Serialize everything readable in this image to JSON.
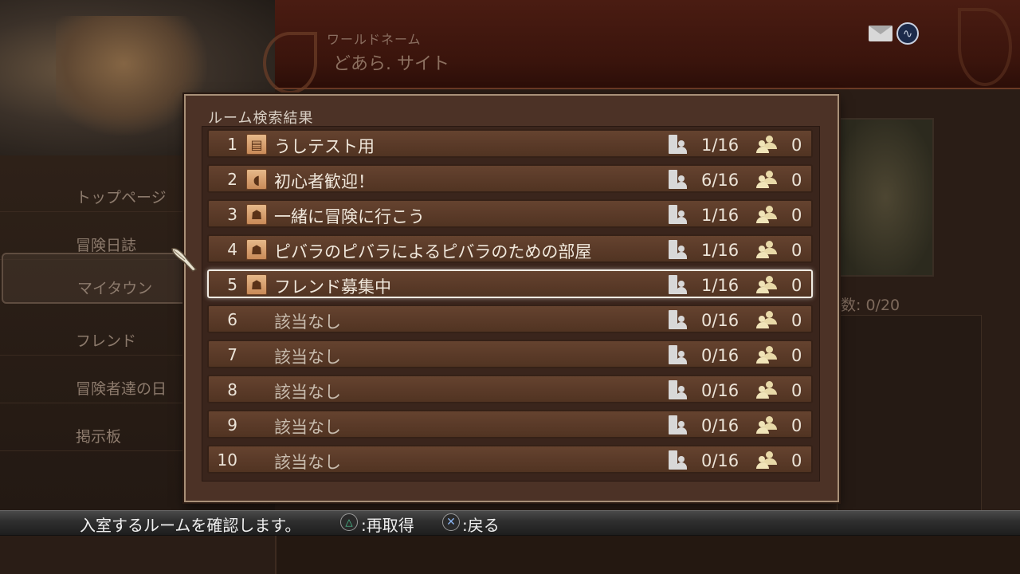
{
  "header": {
    "world_label": "ワールドネーム",
    "world_name": "どあら. サイト",
    "mail_icon": "mail-icon",
    "status_icon": "network-status-icon"
  },
  "side_menu": {
    "items": [
      {
        "label": "トップページ"
      },
      {
        "label": "冒険日誌"
      },
      {
        "label": "マイタウン",
        "selected": true
      },
      {
        "label": "フレンド"
      },
      {
        "label": "冒険者達の日"
      },
      {
        "label": "掲示板"
      }
    ]
  },
  "right_panel": {
    "count_label": "数:",
    "count_value": "0/20"
  },
  "dialog": {
    "title": "ルーム検索結果",
    "rooms": [
      {
        "num": "1",
        "icon": "note-icon",
        "name": "うしテスト用",
        "occupancy": "1/16",
        "members": "0"
      },
      {
        "num": "2",
        "icon": "beginner-icon",
        "name": "初心者歓迎！",
        "occupancy": "6/16",
        "members": "0"
      },
      {
        "num": "3",
        "icon": "party-icon",
        "name": "一緒に冒険に行こう",
        "occupancy": "1/16",
        "members": "0"
      },
      {
        "num": "4",
        "icon": "friends-icon",
        "name": "ピバラのピバラによるピバラのための部屋",
        "occupancy": "1/16",
        "members": "0"
      },
      {
        "num": "5",
        "icon": "friends-icon",
        "name": "フレンド募集中",
        "occupancy": "1/16",
        "members": "0",
        "selected": true
      },
      {
        "num": "6",
        "icon": "",
        "name": "該当なし",
        "occupancy": "0/16",
        "members": "0"
      },
      {
        "num": "7",
        "icon": "",
        "name": "該当なし",
        "occupancy": "0/16",
        "members": "0"
      },
      {
        "num": "8",
        "icon": "",
        "name": "該当なし",
        "occupancy": "0/16",
        "members": "0"
      },
      {
        "num": "9",
        "icon": "",
        "name": "該当なし",
        "occupancy": "0/16",
        "members": "0"
      },
      {
        "num": "10",
        "icon": "",
        "name": "該当なし",
        "occupancy": "0/16",
        "members": "0"
      }
    ]
  },
  "footer": {
    "help_text": "入室するルームを確認します。",
    "triangle_button_label": ":再取得",
    "cross_button_label": ":戻る"
  }
}
